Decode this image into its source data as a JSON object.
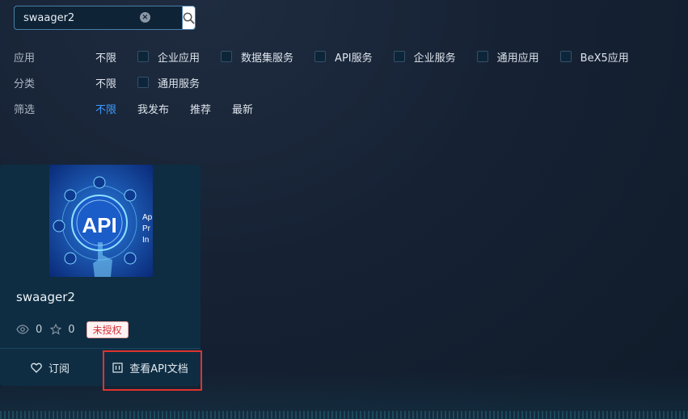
{
  "search": {
    "value": "swaager2",
    "clear_icon": "close-circle-icon",
    "search_icon": "search-icon"
  },
  "filters": {
    "app": {
      "label": "应用",
      "unlimited": "不限",
      "options": [
        "企业应用",
        "数据集服务",
        "API服务",
        "企业服务",
        "通用应用",
        "BeX5应用"
      ]
    },
    "category": {
      "label": "分类",
      "unlimited": "不限",
      "options": [
        "通用服务"
      ]
    },
    "screen": {
      "label": "筛选",
      "options": [
        "不限",
        "我发布",
        "推荐",
        "最新"
      ],
      "active_index": 0
    }
  },
  "card": {
    "title": "swaager2",
    "thumbnail": {
      "center_text": "API",
      "side_text": [
        "Ap",
        "Pr",
        "In"
      ]
    },
    "views": "0",
    "stars": "0",
    "badge": "未授权",
    "subscribe_label": "订阅",
    "docs_label": "查看API文档"
  },
  "colors": {
    "accent": "#3d9bff",
    "highlight": "#e0332d",
    "badge_text": "#d4303a"
  }
}
